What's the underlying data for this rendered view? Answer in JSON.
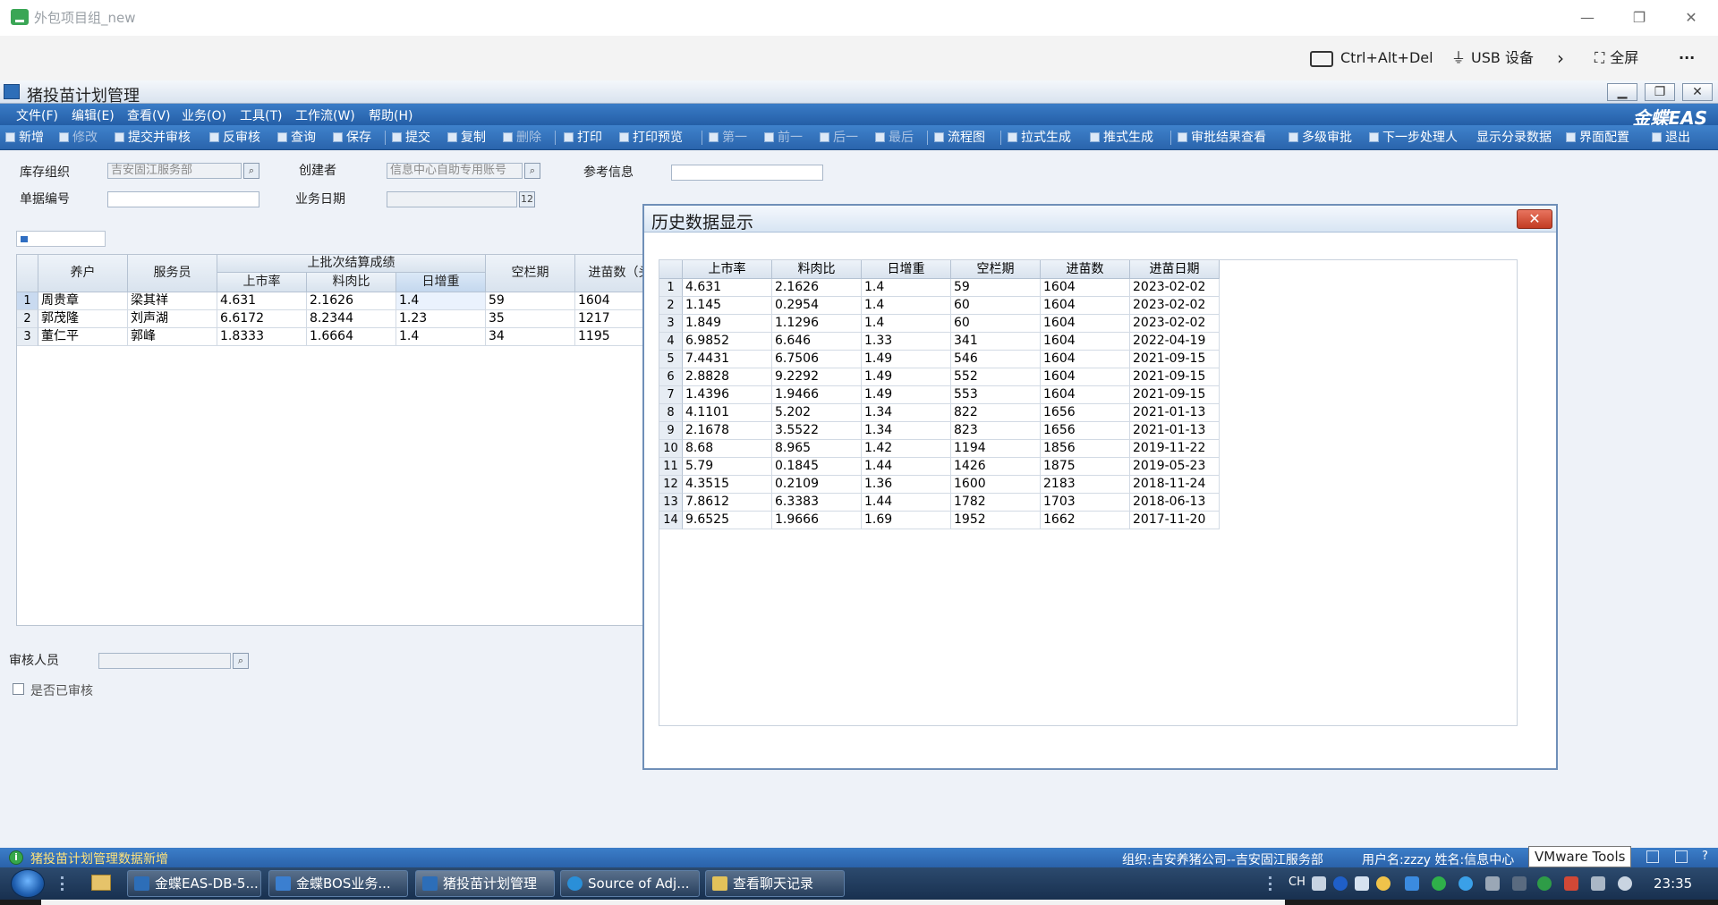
{
  "remote": {
    "title": "外包项目组_new",
    "cad": "Ctrl+Alt+Del",
    "usb": "USB 设备",
    "fullscreen": "全屏",
    "more": "···"
  },
  "window": {
    "title": "猪投苗计划管理",
    "brand": "金蝶EAS"
  },
  "menu": [
    "文件(F)",
    "编辑(E)",
    "查看(V)",
    "业务(O)",
    "工具(T)",
    "工作流(W)",
    "帮助(H)"
  ],
  "toolbar": {
    "new": "新增",
    "edit": "修改",
    "submit_audit": "提交并审核",
    "unaudit": "反审核",
    "query": "查询",
    "save": "保存",
    "submit": "提交",
    "copy": "复制",
    "delete": "删除",
    "print": "打印",
    "print_preview": "打印预览",
    "first": "第一",
    "prev": "前一",
    "next": "后一",
    "last": "最后",
    "flowchart": "流程图",
    "pull_gen": "拉式生成",
    "push_gen": "推式生成",
    "audit_result": "审批结果查看",
    "multi_audit": "多级审批",
    "next_handler": "下一步处理人",
    "show_category": "显示分录数据",
    "ui_config": "界面配置",
    "exit": "退出"
  },
  "form": {
    "stock_org_label": "库存组织",
    "stock_org_value": "吉安固江服务部",
    "creator_label": "创建者",
    "creator_value": "信息中心自助专用账号",
    "ref_label": "参考信息",
    "ref_value": "",
    "bill_no_label": "单据编号",
    "bill_no_value": "",
    "biz_date_label": "业务日期",
    "biz_date_value": "",
    "auditor_label": "审核人员",
    "auditor_value": "",
    "audited_label": "是否已审核"
  },
  "main_table": {
    "headers": {
      "farmer": "养户",
      "service": "服务员",
      "group": "上批次结算成绩",
      "rate": "上市率",
      "ratio": "料肉比",
      "gain": "日增重",
      "empty": "空栏期",
      "count": "进苗数（头"
    },
    "rows": [
      {
        "idx": "1",
        "farmer": "周贵章",
        "service": "梁其祥",
        "rate": "4.631",
        "ratio": "2.1626",
        "gain": "1.4",
        "empty": "59",
        "count": "1604"
      },
      {
        "idx": "2",
        "farmer": "郭茂隆",
        "service": "刘声湖",
        "rate": "6.6172",
        "ratio": "8.2344",
        "gain": "1.23",
        "empty": "35",
        "count": "1217"
      },
      {
        "idx": "3",
        "farmer": "董仁平",
        "service": "郭峰",
        "rate": "1.8333",
        "ratio": "1.6664",
        "gain": "1.4",
        "empty": "34",
        "count": "1195"
      }
    ]
  },
  "dialog": {
    "title": "历史数据显示",
    "close": "✕",
    "headers": [
      "上市率",
      "料肉比",
      "日增重",
      "空栏期",
      "进苗数",
      "进苗日期"
    ],
    "rows": [
      [
        "1",
        "4.631",
        "2.1626",
        "1.4",
        "59",
        "1604",
        "2023-02-02"
      ],
      [
        "2",
        "1.145",
        "0.2954",
        "1.4",
        "60",
        "1604",
        "2023-02-02"
      ],
      [
        "3",
        "1.849",
        "1.1296",
        "1.4",
        "60",
        "1604",
        "2023-02-02"
      ],
      [
        "4",
        "6.9852",
        "6.646",
        "1.33",
        "341",
        "1604",
        "2022-04-19"
      ],
      [
        "5",
        "7.4431",
        "6.7506",
        "1.49",
        "546",
        "1604",
        "2021-09-15"
      ],
      [
        "6",
        "2.8828",
        "9.2292",
        "1.49",
        "552",
        "1604",
        "2021-09-15"
      ],
      [
        "7",
        "1.4396",
        "1.9466",
        "1.49",
        "553",
        "1604",
        "2021-09-15"
      ],
      [
        "8",
        "4.1101",
        "5.202",
        "1.34",
        "822",
        "1656",
        "2021-01-13"
      ],
      [
        "9",
        "2.1678",
        "3.5522",
        "1.34",
        "823",
        "1656",
        "2021-01-13"
      ],
      [
        "10",
        "8.68",
        "8.965",
        "1.42",
        "1194",
        "1856",
        "2019-11-22"
      ],
      [
        "11",
        "5.79",
        "0.1845",
        "1.44",
        "1426",
        "1875",
        "2019-05-23"
      ],
      [
        "12",
        "4.3515",
        "0.2109",
        "1.36",
        "1600",
        "2183",
        "2018-11-24"
      ],
      [
        "13",
        "7.8612",
        "6.3383",
        "1.44",
        "1782",
        "1703",
        "2018-06-13"
      ],
      [
        "14",
        "9.6525",
        "1.9666",
        "1.69",
        "1952",
        "1662",
        "2017-11-20"
      ]
    ]
  },
  "status": {
    "message": "猪投苗计划管理数据新增",
    "org": "组织:吉安养猪公司--吉安固江服务部",
    "user": "用户名:zzzy  姓名:信息中心",
    "tooltip": "VMware Tools"
  },
  "taskbar": {
    "items": [
      "金蝶EAS-DB-5...",
      "金蝶BOS业务...",
      "猪投苗计划管理",
      "Source of Adj...",
      "查看聊天记录"
    ],
    "lang": "CH",
    "clock": "23:35"
  }
}
